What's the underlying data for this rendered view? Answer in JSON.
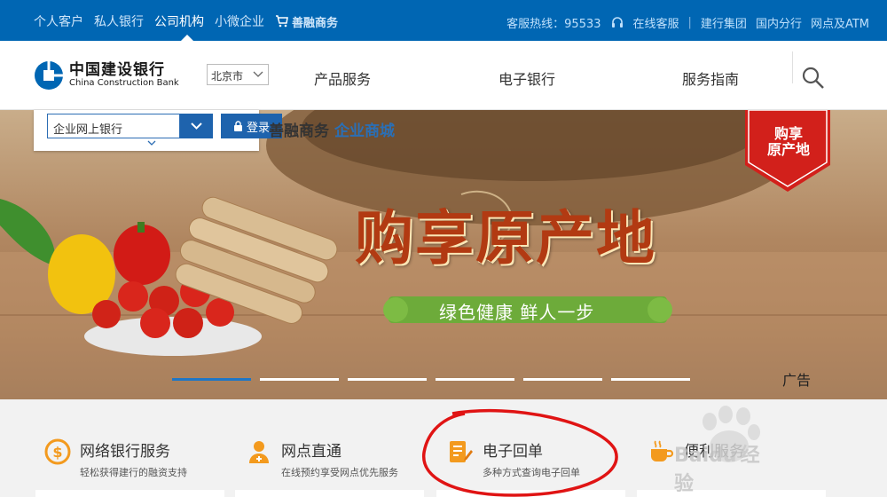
{
  "topbar": {
    "nav": [
      "个人客户",
      "私人银行",
      "公司机构",
      "小微企业"
    ],
    "shan_label": "善融商务",
    "hotline": "客服热线：95533",
    "online_service": "在线客服",
    "links": [
      "建行集团",
      "国内分行",
      "网点及ATM"
    ]
  },
  "header": {
    "logo_zh": "中国建设银行",
    "logo_en": "China Construction Bank",
    "city": "北京市",
    "menu": [
      "产品服务",
      "电子银行",
      "服务指南"
    ]
  },
  "login": {
    "select_value": "企业网上银行",
    "login_label": "登录"
  },
  "banner": {
    "promo_a": "善融商务",
    "promo_b": "企业商城",
    "badge_line1": "购享",
    "badge_line2": "原产地",
    "headline": "购享原产地",
    "ribbon": "绿色健康  鲜人一步",
    "ad_label": "广告",
    "slides": 6,
    "active_slide": 1
  },
  "services": [
    {
      "title": "网络银行服务",
      "sub": "轻松获得建行的融资支持",
      "icon": "dollar-icon"
    },
    {
      "title": "网点直通",
      "sub": "在线预约享受网点优先服务",
      "icon": "person-add-icon"
    },
    {
      "title": "电子回单",
      "sub": "多种方式查询电子回单",
      "icon": "document-edit-icon"
    },
    {
      "title": "便利服务",
      "sub": "",
      "icon": "coffee-cup-icon"
    }
  ],
  "watermark": {
    "text": "经验",
    "brand": "Baidu"
  },
  "colors": {
    "brand_blue": "#0066b3",
    "headline_red": "#b23a12",
    "accent_orange": "#f39a1e",
    "ribbon_green": "#6dab3a"
  }
}
